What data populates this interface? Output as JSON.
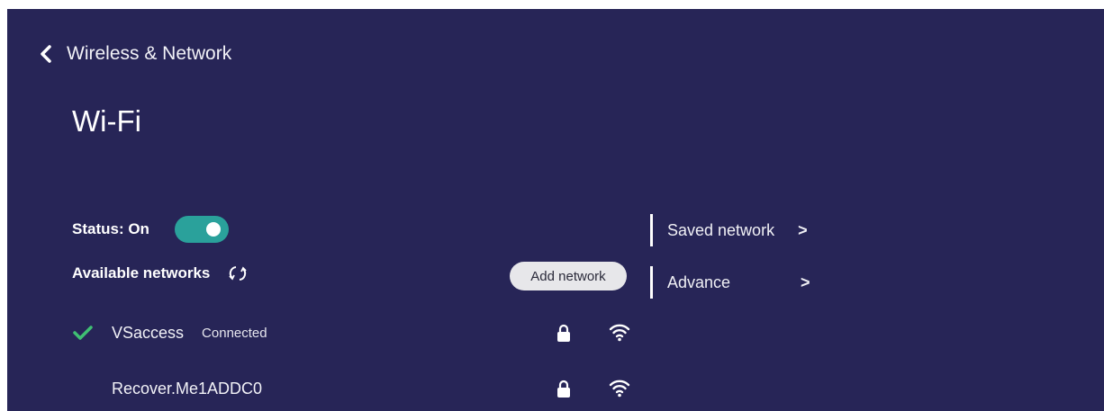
{
  "header": {
    "back_label": "Wireless & Network",
    "title": "Wi-Fi"
  },
  "status": {
    "label": "Status: On",
    "toggle_on": true
  },
  "available": {
    "label": "Available networks",
    "add_network_label": "Add network"
  },
  "side_menu": [
    {
      "label": "Saved network",
      "chevron": ">"
    },
    {
      "label": "Advance",
      "chevron": ">"
    }
  ],
  "networks": [
    {
      "name": "VSaccess",
      "status": "Connected",
      "connected": true,
      "locked": true
    },
    {
      "name": "Recover.Me1ADDC0",
      "status": "",
      "connected": false,
      "locked": true
    }
  ],
  "colors": {
    "background": "#272557",
    "toggle": "#2aa19b",
    "check": "#3fbf73",
    "button": "#e7e7ea"
  },
  "icons": [
    "back-arrow-icon",
    "refresh-icon",
    "check-icon",
    "lock-icon",
    "wifi-icon",
    "chevron-right-icon"
  ]
}
